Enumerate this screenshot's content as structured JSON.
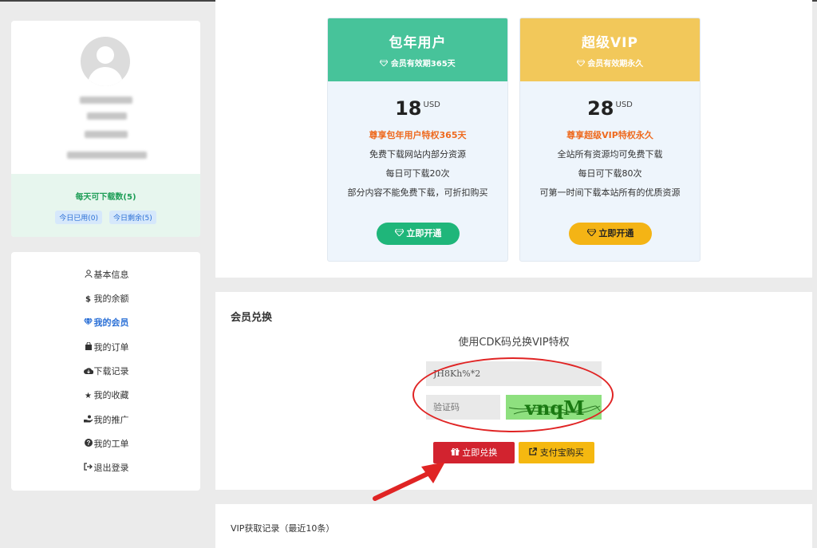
{
  "sidebar": {
    "quota": {
      "title": "每天可下载数(5)",
      "used_label": "今日已用(0)",
      "remain_label": "今日剩余(5)"
    },
    "menu": [
      {
        "label": "基本信息",
        "icon": "user-icon"
      },
      {
        "label": "我的余额",
        "icon": "dollar-icon"
      },
      {
        "label": "我的会员",
        "icon": "diamond-icon"
      },
      {
        "label": "我的订单",
        "icon": "bag-icon"
      },
      {
        "label": "下载记录",
        "icon": "cloud-download-icon"
      },
      {
        "label": "我的收藏",
        "icon": "star-icon"
      },
      {
        "label": "我的推广",
        "icon": "hand-coin-icon"
      },
      {
        "label": "我的工单",
        "icon": "question-icon"
      },
      {
        "label": "退出登录",
        "icon": "sign-out-icon"
      }
    ],
    "active_index": 2
  },
  "plans": [
    {
      "title": "包年用户",
      "subtitle": "会员有效期365天",
      "price": "18",
      "unit": "USD",
      "highlight": "尊享包年用户特权365天",
      "features": [
        "免费下载网站内部分资源",
        "每日可下载20次",
        "部分内容不能免费下载，可折扣购买"
      ],
      "button": "立即开通",
      "color": "#47c39a"
    },
    {
      "title": "超级VIP",
      "subtitle": "会员有效期永久",
      "price": "28",
      "unit": "USD",
      "highlight": "尊享超级VIP特权永久",
      "features": [
        "全站所有资源均可免费下载",
        "每日可下载80次",
        "可第一时间下载本站所有的优质资源"
      ],
      "button": "立即开通",
      "color": "#f2c85a"
    }
  ],
  "redeem": {
    "title": "会员兑换",
    "subtitle": "使用CDK码兑换VIP特权",
    "cdk_value": "JH8Kh%*2",
    "captcha_placeholder": "验证码",
    "captcha_text": "vnqM",
    "redeem_button": "立即兑换",
    "alipay_button": "支付宝购买"
  },
  "history": {
    "title": "VIP获取记录（最近10条）"
  }
}
